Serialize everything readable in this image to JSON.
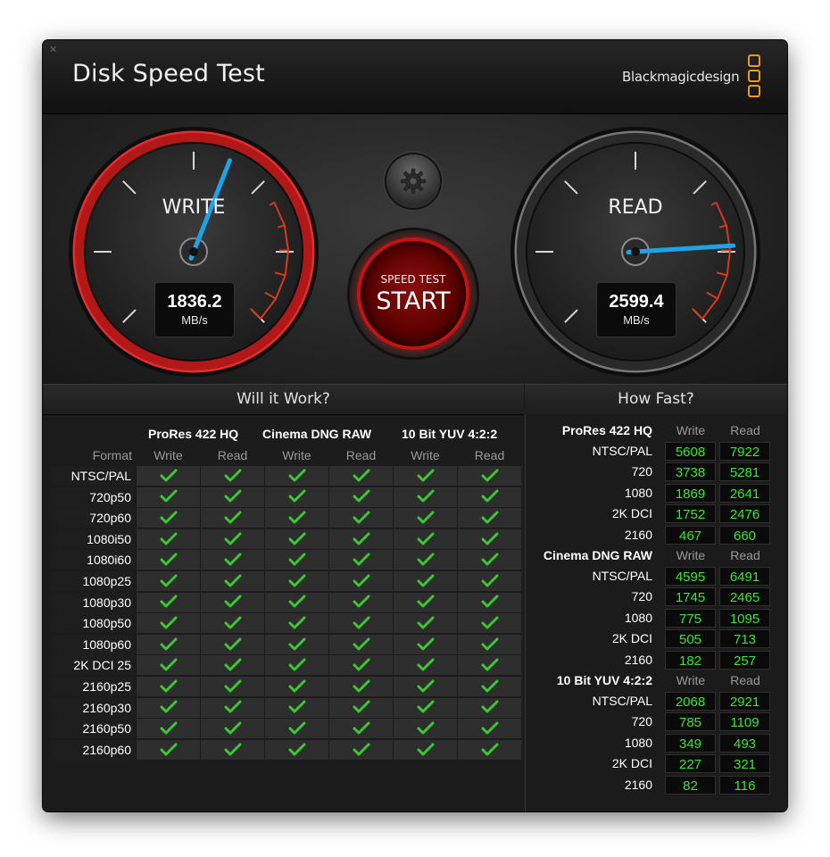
{
  "window": {
    "title": "Disk Speed Test",
    "brand": "Blackmagicdesign",
    "close_icon": "close-icon"
  },
  "gauges": {
    "write": {
      "label": "WRITE",
      "value": "1836.2",
      "unit": "MB/s",
      "needle_fraction": 0.58
    },
    "read": {
      "label": "READ",
      "value": "2599.4",
      "unit": "MB/s",
      "needle_fraction": 0.82
    }
  },
  "start_button": {
    "line1": "SPEED TEST",
    "line2": "START"
  },
  "settings_icon": "gear-icon",
  "colors": {
    "accent_green": "#37e82f",
    "start_red": "#c61212",
    "needle_blue": "#1fa3e8",
    "brand_orange": "#f09a1a"
  },
  "will_it_work": {
    "heading": "Will it Work?",
    "format_header": "Format",
    "codecs": [
      "ProRes 422 HQ",
      "Cinema DNG RAW",
      "10 Bit YUV 4:2:2"
    ],
    "subheads": [
      "Write",
      "Read",
      "Write",
      "Read",
      "Write",
      "Read"
    ],
    "rows": [
      "NTSC/PAL",
      "720p50",
      "720p60",
      "1080i50",
      "1080i60",
      "1080p25",
      "1080p30",
      "1080p50",
      "1080p60",
      "2K DCI 25",
      "2160p25",
      "2160p30",
      "2160p50",
      "2160p60"
    ],
    "check_icon": "checkmark-icon"
  },
  "how_fast": {
    "heading": "How Fast?",
    "write_label": "Write",
    "read_label": "Read",
    "groups": [
      {
        "codec": "ProRes 422 HQ",
        "rows": [
          {
            "format": "NTSC/PAL",
            "write": "5608",
            "read": "7922"
          },
          {
            "format": "720",
            "write": "3738",
            "read": "5281"
          },
          {
            "format": "1080",
            "write": "1869",
            "read": "2641"
          },
          {
            "format": "2K DCI",
            "write": "1752",
            "read": "2476"
          },
          {
            "format": "2160",
            "write": "467",
            "read": "660"
          }
        ]
      },
      {
        "codec": "Cinema DNG RAW",
        "rows": [
          {
            "format": "NTSC/PAL",
            "write": "4595",
            "read": "6491"
          },
          {
            "format": "720",
            "write": "1745",
            "read": "2465"
          },
          {
            "format": "1080",
            "write": "775",
            "read": "1095"
          },
          {
            "format": "2K DCI",
            "write": "505",
            "read": "713"
          },
          {
            "format": "2160",
            "write": "182",
            "read": "257"
          }
        ]
      },
      {
        "codec": "10 Bit YUV 4:2:2",
        "rows": [
          {
            "format": "NTSC/PAL",
            "write": "2068",
            "read": "2921"
          },
          {
            "format": "720",
            "write": "785",
            "read": "1109"
          },
          {
            "format": "1080",
            "write": "349",
            "read": "493"
          },
          {
            "format": "2K DCI",
            "write": "227",
            "read": "321"
          },
          {
            "format": "2160",
            "write": "82",
            "read": "116"
          }
        ]
      }
    ]
  }
}
